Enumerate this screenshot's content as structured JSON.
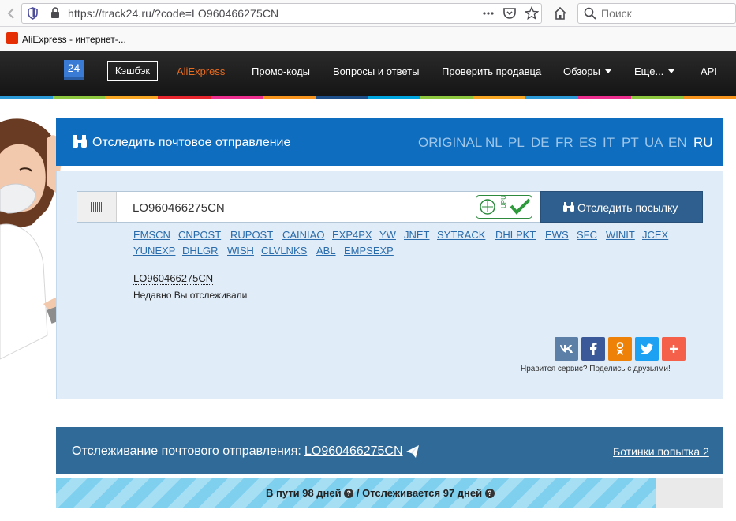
{
  "browser": {
    "url": "https://track24.ru/?code=LO960466275CN",
    "search_placeholder": "Поиск",
    "bookmark_label": "AliExpress - интернет-..."
  },
  "nav": {
    "logo": "24",
    "cashback": "Кэшбэк",
    "items": [
      {
        "label": "AliExpress"
      },
      {
        "label": "Промо-коды"
      },
      {
        "label": "Вопросы и ответы"
      },
      {
        "label": "Проверить продавца"
      },
      {
        "label": "Обзоры"
      },
      {
        "label": "Еще..."
      },
      {
        "label": "API"
      }
    ],
    "accent": "#e86b1f"
  },
  "tracker": {
    "title": "Отследить почтовое отправление",
    "languages": [
      "ORIGINAL",
      "NL",
      "PL",
      "DE",
      "FR",
      "ES",
      "IT",
      "PT",
      "UA",
      "EN",
      "RU"
    ],
    "active_language": "RU",
    "input_value": "LO960466275CN",
    "button_label": "Отследить посылку",
    "carriers": [
      "EMSCN",
      "CNPOST",
      "RUPOST",
      "CAINIAO",
      "EXP4PX",
      "YW",
      "JNET",
      "SYTRACK",
      "DHLPKT",
      "EWS",
      "SFC",
      "WINIT",
      "JCEX",
      "YUNEXP",
      "DHLGR",
      "WISH",
      "CLVLNKS",
      "ABL",
      "EMPSEXP"
    ],
    "recent_code": "LO960466275CN",
    "recent_label": "Недавно Вы отслеживали",
    "share_text": "Нравится сервис? Поделись с друзьями!",
    "primary_color": "#0e6dbf"
  },
  "result": {
    "title": "Отслеживание почтового отправления:",
    "code": "LO960466275CN",
    "link_right": "Ботинки попытка 2",
    "in_transit": "В пути 98 дней",
    "separator": "/",
    "tracked": "Отслеживается 97 дней"
  }
}
